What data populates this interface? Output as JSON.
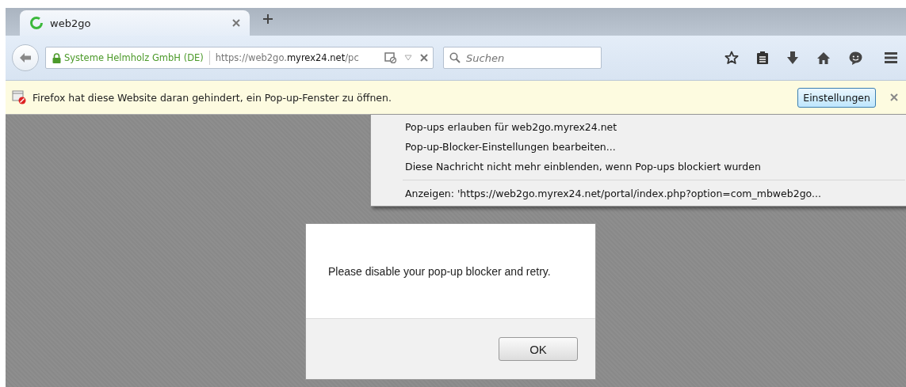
{
  "tabs": [
    {
      "title": "web2go",
      "selected": true
    }
  ],
  "nav": {
    "identity": "Systeme Helmholz GmbH (DE)",
    "url_prefix": "https://web2go.",
    "url_domain": "myrex24.net",
    "url_rest": "/pc",
    "search": {
      "placeholder": "Suchen"
    }
  },
  "notification": {
    "message": "Firefox hat diese Website daran gehindert, ein Pop-up-Fenster zu öffnen.",
    "button": "Einstellungen"
  },
  "menu": [
    {
      "label": "Pop-ups erlauben für web2go.myrex24.net",
      "kind": "item"
    },
    {
      "label": "Pop-up-Blocker-Einstellungen bearbeiten...",
      "kind": "item"
    },
    {
      "label": "Diese Nachricht nicht mehr einblenden, wenn Pop-ups blockiert wurden",
      "kind": "item"
    },
    {
      "kind": "separator"
    },
    {
      "label": "Anzeigen: 'https://web2go.myrex24.net/portal/index.php?option=com_mbweb2go...",
      "kind": "item"
    }
  ],
  "dialog": {
    "message": "Please disable your pop-up blocker and retry.",
    "button": "OK"
  }
}
